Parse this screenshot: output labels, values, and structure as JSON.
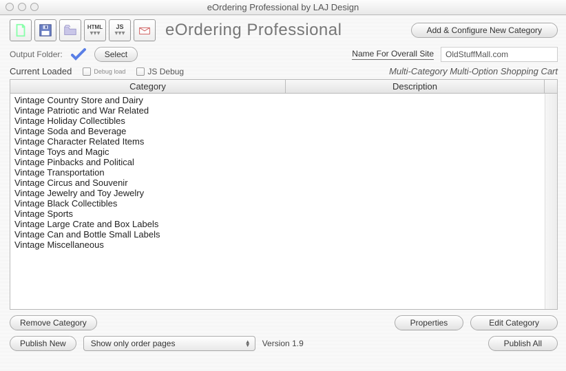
{
  "window": {
    "title": "eOrdering Professional by LAJ Design"
  },
  "header": {
    "app_title": "eOrdering Professional",
    "add_category_btn": "Add & Configure New Category"
  },
  "row2": {
    "output_folder_label": "Output Folder:",
    "select_btn": "Select",
    "site_name_label": "Name For Overall Site",
    "site_name_value": "OldStuffMall.com"
  },
  "row3": {
    "current_loaded": "Current Loaded",
    "debug_load": "Debug load",
    "js_debug": "JS Debug",
    "cart_text": "Multi-Category Multi-Option Shopping Cart"
  },
  "table": {
    "col_category": "Category",
    "col_description": "Description",
    "rows": [
      "Vintage Country Store and Dairy",
      "Vintage Patriotic and War Related",
      "Vintage Holiday Collectibles",
      "Vintage Soda and Beverage",
      "Vintage Character Related Items",
      "Vintage Toys and Magic",
      "Vintage Pinbacks and Political",
      "Vintage Transportation",
      "Vintage Circus and Souvenir",
      "Vintage Jewelry and Toy Jewelry",
      "Vintage Black Collectibles",
      "Vintage Sports",
      "Vintage Large Crate and Box Labels",
      "Vintage Can and Bottle Small Labels",
      "Vintage Miscellaneous"
    ]
  },
  "bottom": {
    "remove_btn": "Remove Category",
    "properties_btn": "Properties",
    "edit_btn": "Edit Category",
    "publish_new_btn": "Publish New",
    "select_label": "Show only order pages",
    "version_label": "Version 1.9",
    "publish_all_btn": "Publish All"
  }
}
